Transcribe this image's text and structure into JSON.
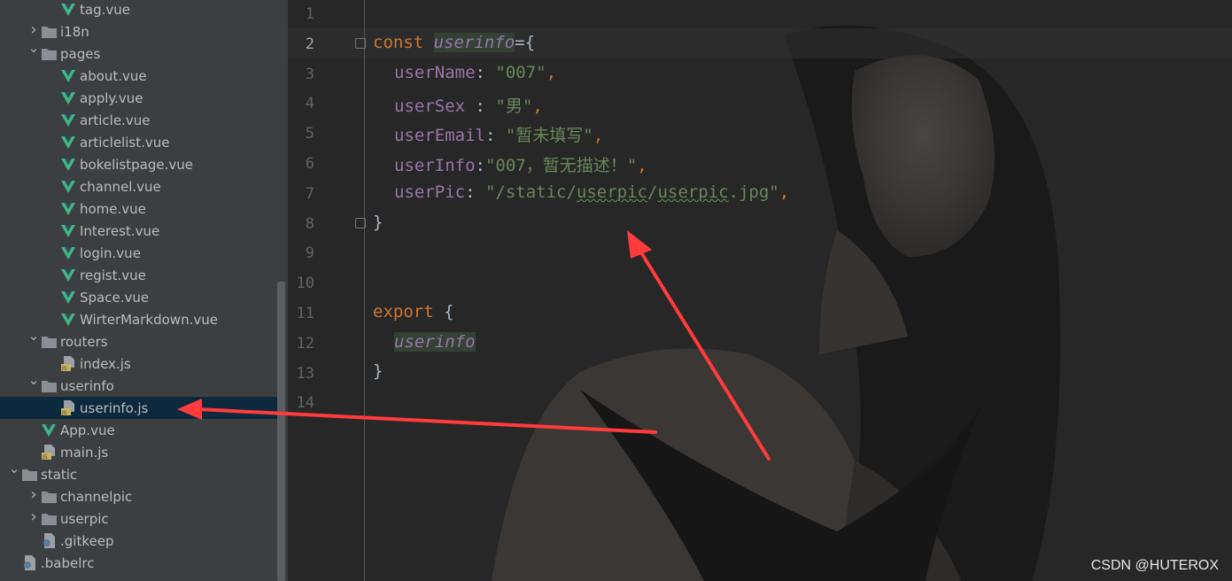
{
  "file_tree": [
    {
      "depth": 4,
      "type": "vue",
      "label": "tag.vue",
      "arrow": ""
    },
    {
      "depth": 3,
      "type": "folder",
      "label": "i18n",
      "arrow": "collapsed"
    },
    {
      "depth": 3,
      "type": "folder",
      "label": "pages",
      "arrow": "expanded"
    },
    {
      "depth": 4,
      "type": "vue",
      "label": "about.vue",
      "arrow": ""
    },
    {
      "depth": 4,
      "type": "vue",
      "label": "apply.vue",
      "arrow": ""
    },
    {
      "depth": 4,
      "type": "vue",
      "label": "article.vue",
      "arrow": ""
    },
    {
      "depth": 4,
      "type": "vue",
      "label": "articlelist.vue",
      "arrow": ""
    },
    {
      "depth": 4,
      "type": "vue",
      "label": "bokelistpage.vue",
      "arrow": ""
    },
    {
      "depth": 4,
      "type": "vue",
      "label": "channel.vue",
      "arrow": ""
    },
    {
      "depth": 4,
      "type": "vue",
      "label": "home.vue",
      "arrow": ""
    },
    {
      "depth": 4,
      "type": "vue",
      "label": "Interest.vue",
      "arrow": ""
    },
    {
      "depth": 4,
      "type": "vue",
      "label": "login.vue",
      "arrow": ""
    },
    {
      "depth": 4,
      "type": "vue",
      "label": "regist.vue",
      "arrow": ""
    },
    {
      "depth": 4,
      "type": "vue",
      "label": "Space.vue",
      "arrow": ""
    },
    {
      "depth": 4,
      "type": "vue",
      "label": "WirterMarkdown.vue",
      "arrow": ""
    },
    {
      "depth": 3,
      "type": "folder",
      "label": "routers",
      "arrow": "expanded"
    },
    {
      "depth": 4,
      "type": "js",
      "label": "index.js",
      "arrow": ""
    },
    {
      "depth": 3,
      "type": "folder",
      "label": "userinfo",
      "arrow": "expanded"
    },
    {
      "depth": 4,
      "type": "js",
      "label": "userinfo.js",
      "arrow": "",
      "selected": true
    },
    {
      "depth": 3,
      "type": "vue",
      "label": "App.vue",
      "arrow": ""
    },
    {
      "depth": 3,
      "type": "js",
      "label": "main.js",
      "arrow": ""
    },
    {
      "depth": 2,
      "type": "folder",
      "label": "static",
      "arrow": "expanded"
    },
    {
      "depth": 3,
      "type": "folder",
      "label": "channelpic",
      "arrow": "collapsed"
    },
    {
      "depth": 3,
      "type": "folder",
      "label": "userpic",
      "arrow": "collapsed"
    },
    {
      "depth": 3,
      "type": "config",
      "label": ".gitkeep",
      "arrow": ""
    },
    {
      "depth": 2,
      "type": "config",
      "label": ".babelrc",
      "arrow": ""
    }
  ],
  "line_numbers": [
    "1",
    "2",
    "3",
    "4",
    "5",
    "6",
    "7",
    "8",
    "9",
    "10",
    "11",
    "12",
    "13",
    "14"
  ],
  "code": {
    "l2_kw": "const",
    "l2_ident": "userinfo",
    "l2_rest": "={",
    "l3_prop": "userName",
    "l3_sep": ": ",
    "l3_val": "\"007\"",
    "l4_prop": "userSex",
    "l4_sep": " : ",
    "l4_val": "\"男\"",
    "l5_prop": "userEmail",
    "l5_sep": ": ",
    "l5_val": "\"暂未填写\"",
    "l6_prop": "userInfo",
    "l6_sep": ":",
    "l6_val": "\"007，暂无描述！\"",
    "l7_prop": "userPic",
    "l7_sep": ": ",
    "l7_val_a": "\"/static/",
    "l7_val_b": "userpic",
    "l7_val_c": "/",
    "l7_val_d": "userpic",
    "l7_val_e": ".jpg\"",
    "comma": ",",
    "l8": "}",
    "l11_kw": "export",
    "l11_rest": " {",
    "l12_ident": "userinfo",
    "l13": "}"
  },
  "watermark": "CSDN @HUTEROX",
  "colors": {
    "vue_icon": "#41b883",
    "folder_icon": "#8a8f95",
    "js_icon": "#cbb35c",
    "annotation_arrow": "#ff3b3b"
  }
}
